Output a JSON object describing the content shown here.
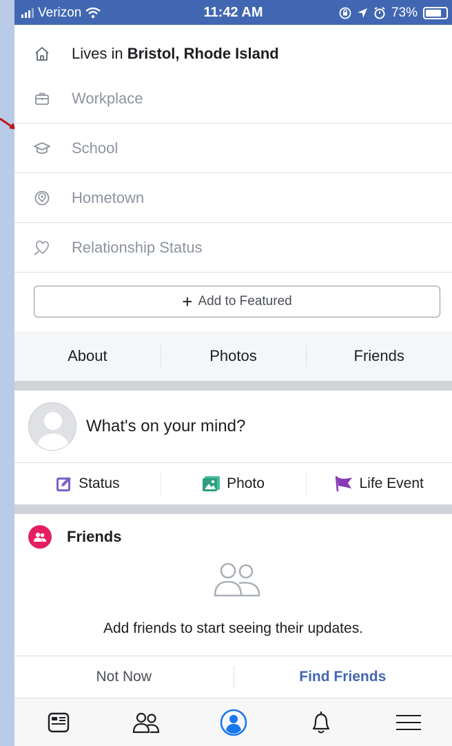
{
  "status_bar": {
    "carrier": "Verizon",
    "time": "11:42 AM",
    "battery": "73%"
  },
  "intro": {
    "lives_prefix": "Lives in",
    "lives_place": "Bristol, Rhode Island",
    "workplace": "Workplace",
    "school": "School",
    "hometown": "Hometown",
    "relationship": "Relationship Status"
  },
  "featured": {
    "plus": "+",
    "label": "Add to Featured"
  },
  "profile_tabs": [
    "About",
    "Photos",
    "Friends"
  ],
  "composer": {
    "prompt": "What's on your mind?",
    "status": "Status",
    "photo": "Photo",
    "life_event": "Life Event"
  },
  "friends_card": {
    "title": "Friends",
    "message": "Add friends to start seeing their updates.",
    "not_now": "Not Now",
    "find_friends": "Find Friends"
  },
  "tab_bar": {
    "items": [
      "news-feed-icon",
      "friends-icon",
      "profile-icon",
      "notifications-icon",
      "menu-icon"
    ],
    "active": "profile-icon"
  },
  "colors": {
    "brand": "#4267b2",
    "active_tab": "#1877f2",
    "friends_badge": "#e41e63",
    "status_icon": "#7b61c9",
    "photo_icon": "#44bea0",
    "life_event_icon": "#8a3ab9"
  }
}
